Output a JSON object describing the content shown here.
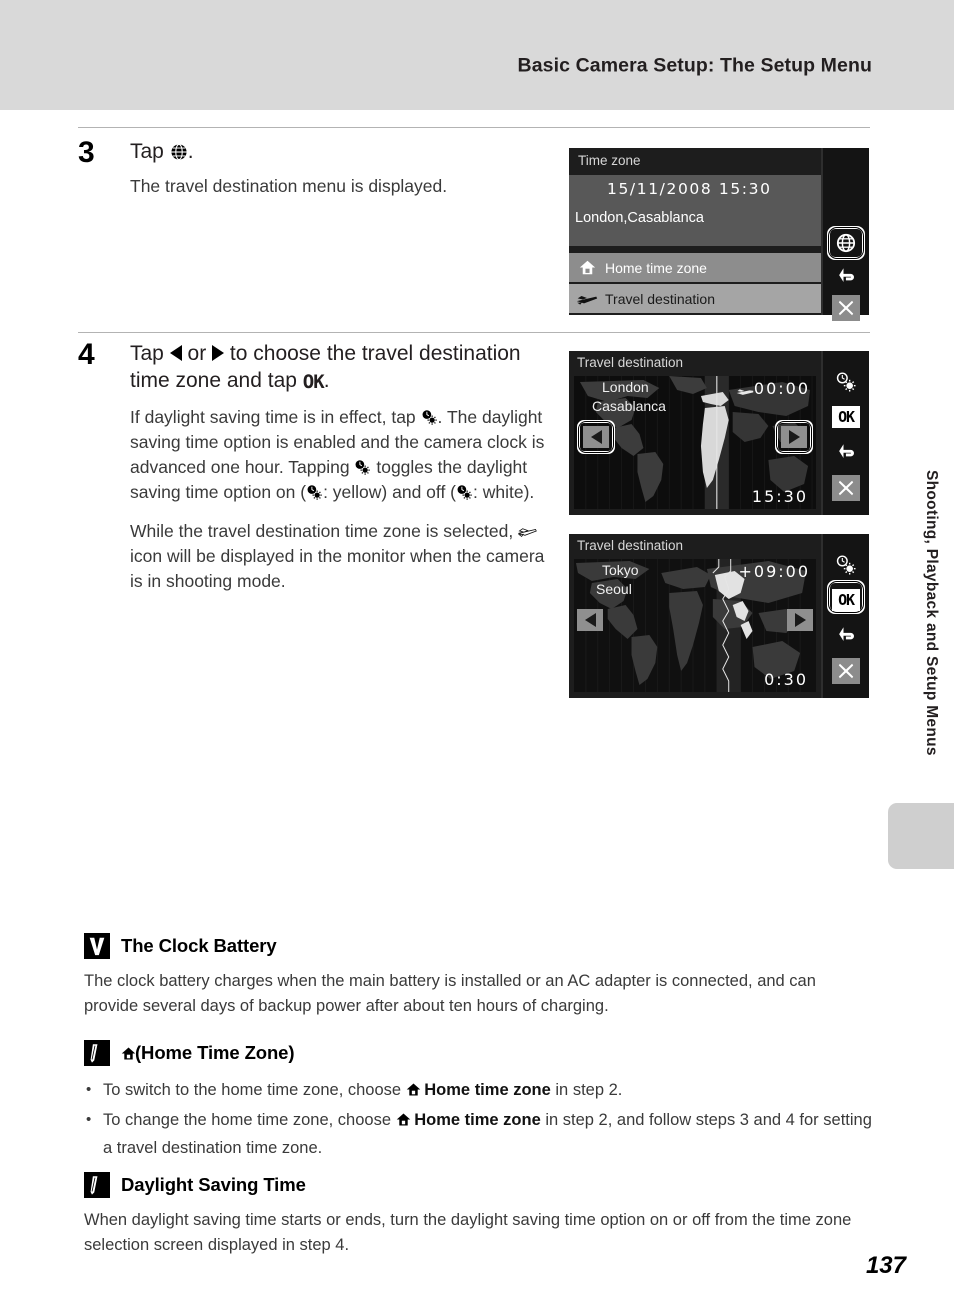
{
  "header": {
    "title": "Basic Camera Setup: The Setup Menu"
  },
  "side_tab": {
    "label": "Shooting, Playback and Setup Menus"
  },
  "page_number": "137",
  "steps": [
    {
      "number": "3",
      "title_before": "Tap",
      "title_icon": "globe-icon",
      "title_after": ".",
      "paragraphs": [
        "The travel destination menu is displayed."
      ]
    },
    {
      "number": "4",
      "title_part1": "Tap",
      "title_part2": "or",
      "title_part3": "to choose the travel destination time zone and tap",
      "title_ok": "OK",
      "title_end": ".",
      "para1_a": "If daylight saving time is in effect, tap",
      "para1_b": ". The daylight saving time option is enabled and the camera clock is advanced one hour. Tapping",
      "para1_c": "toggles the daylight saving time option on (",
      "para1_d": ": yellow) and off (",
      "para1_e": ": white).",
      "para2_a": "While the travel destination time zone is selected,",
      "para2_b": "icon will be displayed in the monitor when the camera is in shooting mode."
    }
  ],
  "screens": {
    "time_zone": {
      "title": "Time zone",
      "datetime": "15/11/2008  15:30",
      "city": "London,Casablanca",
      "rows": [
        {
          "icon": "home-icon",
          "label": "Home time zone"
        },
        {
          "icon": "plane-icon",
          "label": "Travel destination"
        }
      ],
      "side_buttons": [
        {
          "icon": "globe-icon",
          "highlighted": true
        },
        {
          "icon": "back-arrow-icon",
          "highlighted": false
        },
        {
          "icon": "close-x-icon",
          "highlighted": false
        }
      ]
    },
    "travel_london": {
      "title": "Travel destination",
      "city_line1": "London",
      "city_line2": "Casablanca",
      "offset": "00:00",
      "offset_has_plane": true,
      "time": "15:30",
      "left_arrow_highlighted": true,
      "right_arrow_highlighted": true,
      "side_buttons": [
        {
          "icon": "daylight-saving-icon",
          "highlighted": false
        },
        {
          "icon": "ok-icon",
          "label": "OK",
          "highlighted": false
        },
        {
          "icon": "back-arrow-icon",
          "highlighted": false
        },
        {
          "icon": "close-x-icon",
          "highlighted": false
        }
      ]
    },
    "travel_tokyo": {
      "title": "Travel destination",
      "city_line1": "Tokyo",
      "city_line2": "Seoul",
      "offset": "+09:00",
      "offset_has_plane": false,
      "time": "0:30",
      "left_arrow_highlighted": false,
      "right_arrow_highlighted": false,
      "side_buttons": [
        {
          "icon": "daylight-saving-icon",
          "highlighted": false
        },
        {
          "icon": "ok-icon",
          "label": "OK",
          "highlighted": true
        },
        {
          "icon": "back-arrow-icon",
          "highlighted": false
        },
        {
          "icon": "close-x-icon",
          "highlighted": false
        }
      ]
    }
  },
  "notes": [
    {
      "badge": "caution-icon",
      "title": "The Clock Battery",
      "body": "The clock battery charges when the main battery is installed or an AC adapter is connected, and can provide several days of backup power after about ten hours of charging."
    },
    {
      "badge": "pencil-icon",
      "title_icon": "home-icon",
      "title": "(Home Time Zone)",
      "bullets": [
        {
          "a": "To switch to the home time zone, choose",
          "b": "Home time zone",
          "c": "in step 2."
        },
        {
          "a": "To change the home time zone, choose",
          "b": "Home time zone",
          "c": "in step 2, and follow steps 3 and 4 for setting a travel destination time zone."
        }
      ]
    },
    {
      "badge": "pencil-icon",
      "title": "Daylight Saving Time",
      "body": "When daylight saving time starts or ends, turn the daylight saving time option on or off from the time zone selection screen displayed in step 4."
    }
  ],
  "colors": {
    "header_bg": "#d9d9d9",
    "screen_bg": "#1a1a1a",
    "panel_gray": "#585858",
    "row_gray_1": "#8d8d8d",
    "row_gray_2": "#a5a5a5",
    "text": "#231f20"
  }
}
